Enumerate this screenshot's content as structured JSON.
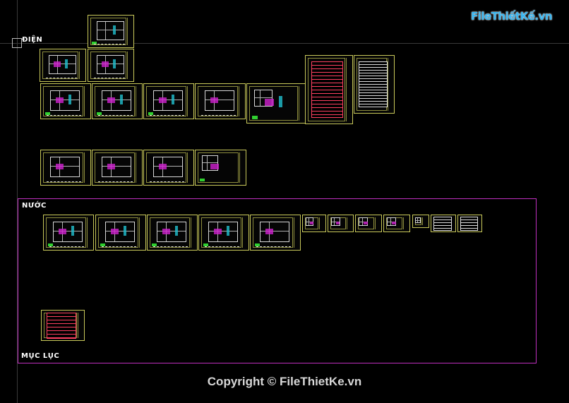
{
  "labels": {
    "dien": "ĐIỆN",
    "nuoc": "NƯỚC",
    "muc_luc": "MỤC LỤC"
  },
  "watermark": {
    "logo_text": "FileThiếtKế.vn",
    "copyright": "Copyright © FileThietKe.vn"
  },
  "colors": {
    "background": "#000000",
    "sheet_border": "#c9c95a",
    "zone_border": "#c030c0"
  }
}
